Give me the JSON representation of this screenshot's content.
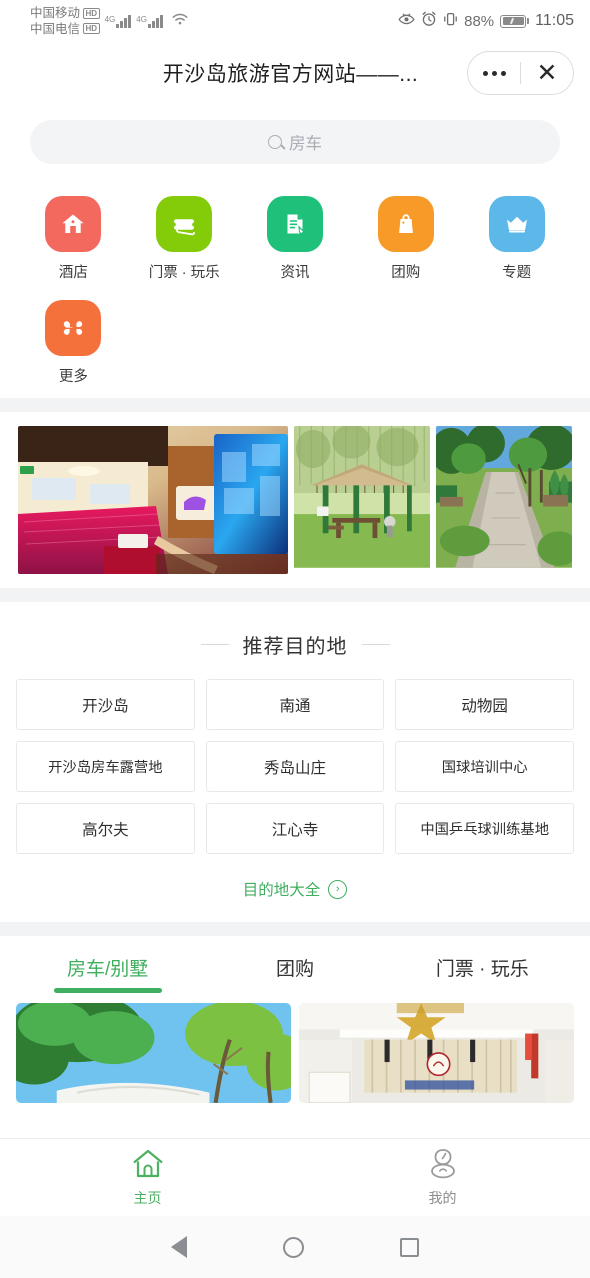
{
  "status_bar": {
    "carrier_primary": "中国移动",
    "carrier_primary_badge": "HD",
    "carrier_secondary": "中国电信",
    "carrier_secondary_badge": "HD",
    "network_1": "4G",
    "network_2": "4G",
    "wifi_icon": "wifi-icon",
    "eye_icon": "eye-comfort-icon",
    "alarm_icon": "alarm-clock-icon",
    "vibrate_icon": "vibrate-icon",
    "battery_percent": "88%",
    "time": "11:05"
  },
  "title_bar": {
    "title": "开沙岛旅游官方网站——...",
    "menu_icon": "more-options-icon",
    "close_icon": "close-icon"
  },
  "search": {
    "icon": "search-icon",
    "placeholder": "房车",
    "value": ""
  },
  "quick_entries": [
    {
      "label": "酒店",
      "icon": "home-icon",
      "color": "#f4695e"
    },
    {
      "label": "门票 · 玩乐",
      "icon": "ticket-icon",
      "color": "#84cc0a"
    },
    {
      "label": "资讯",
      "icon": "document-edit-icon",
      "color": "#1ec07a"
    },
    {
      "label": "团购",
      "icon": "shopping-bag-icon",
      "color": "#f79a28"
    },
    {
      "label": "专题",
      "icon": "crown-icon",
      "color": "#5bb8e8"
    },
    {
      "label": "更多",
      "icon": "clover-grid-icon",
      "color": "#f5713c"
    }
  ],
  "banner_photos": [
    {
      "name": "rv-interior-photo",
      "alt": "房车内饰"
    },
    {
      "name": "gazebo-photo",
      "alt": "草地凉亭"
    },
    {
      "name": "tree-path-photo",
      "alt": "林间小路"
    }
  ],
  "destination_section": {
    "title": "推荐目的地",
    "items": [
      {
        "label": "开沙岛"
      },
      {
        "label": "南通"
      },
      {
        "label": "动物园"
      },
      {
        "label": "开沙岛房车露营地"
      },
      {
        "label": "秀岛山庄"
      },
      {
        "label": "国球培训中心"
      },
      {
        "label": "高尔夫"
      },
      {
        "label": "江心寺"
      },
      {
        "label": "中国乒乓球训练基地"
      }
    ],
    "more_label": "目的地大全",
    "more_icon": "chevron-right-circle-icon"
  },
  "tabs": [
    {
      "label": "房车/别墅",
      "active": true
    },
    {
      "label": "团购",
      "active": false
    },
    {
      "label": "门票 · 玩乐",
      "active": false
    }
  ],
  "cards": [
    {
      "name": "tree-sky-card",
      "alt": "绿树蓝天"
    },
    {
      "name": "hall-interior-card",
      "alt": "大厅内景"
    }
  ],
  "bottom_nav": [
    {
      "label": "主页",
      "icon": "home-outline-icon",
      "active": true
    },
    {
      "label": "我的",
      "icon": "user-outline-icon",
      "active": false
    }
  ],
  "android_nav": {
    "back_icon": "back-triangle-icon",
    "home_icon": "home-circle-icon",
    "recents_icon": "recents-square-icon"
  },
  "colors": {
    "accent_green": "#3fae5e",
    "link_green": "#3fae5e",
    "page_bg": "#f2f3f5"
  }
}
